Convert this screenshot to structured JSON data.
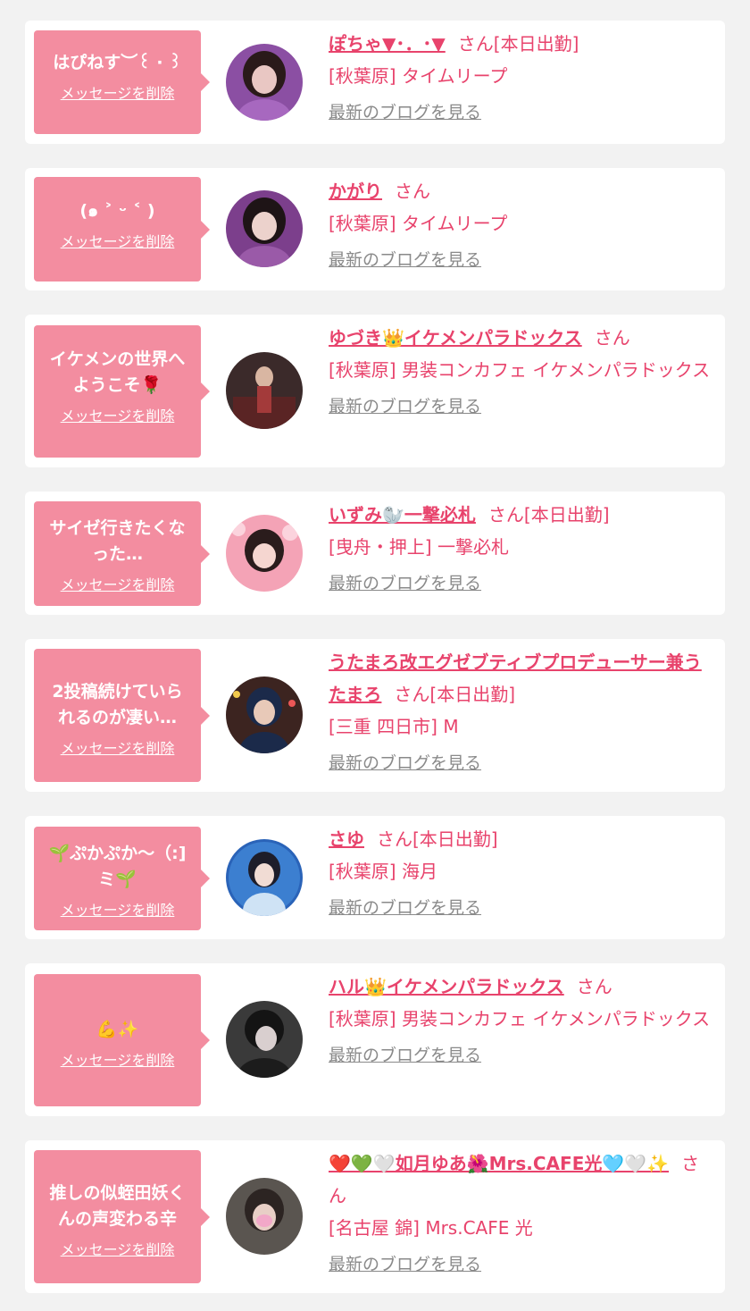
{
  "entries": [
    {
      "message": "はぴねす︶꒰ ‧ ꒱",
      "delete_label": "メッセージを削除",
      "name": "ぽちゃ▼･．･▼",
      "suffix": "さん[本日出勤]",
      "shop": "[秋葉原] タイムリープ",
      "blog_label": "最新のブログを見る",
      "avatar_colors": [
        "#8b4fa3",
        "#2a1a1a",
        "#e9c7c3"
      ]
    },
    {
      "message": "(๑ ˃ ᵕ ˂ )",
      "delete_label": "メッセージを削除",
      "name": "かがり",
      "suffix": "さん",
      "shop": "[秋葉原] タイムリープ",
      "blog_label": "最新のブログを見る",
      "avatar_colors": [
        "#7c3f8c",
        "#1e1416",
        "#ecd2cc"
      ]
    },
    {
      "message": "イケメンの世界へ\nようこそ🌹",
      "delete_label": "メッセージを削除",
      "name": "ゆづき👑イケメンパラドックス",
      "suffix": "さん",
      "shop": "[秋葉原] 男装コンカフェ イケメンパラドックス",
      "blog_label": "最新のブログを見る",
      "avatar_colors": [
        "#3b2a2a",
        "#a33a3a",
        "#d9b6a2"
      ]
    },
    {
      "message": "サイゼ行きたくな\nった…",
      "delete_label": "メッセージを削除",
      "name": "いずみ🦭一撃必札",
      "suffix": "さん[本日出勤]",
      "shop": "[曳舟・押上] 一撃必札",
      "blog_label": "最新のブログを見る",
      "avatar_colors": [
        "#f4a3b6",
        "#2a1c1c",
        "#f5d6d0"
      ]
    },
    {
      "message": "2投稿続けていら\nれるのが凄い…",
      "delete_label": "メッセージを削除",
      "name": "うたまろ改エグゼブティブプロデューサー兼うたまろ",
      "suffix": "さん[本日出勤]",
      "shop": "[三重 四日市] M",
      "blog_label": "最新のブログを見る",
      "avatar_colors": [
        "#3c2420",
        "#1b2a4a",
        "#e8c9b8"
      ]
    },
    {
      "message": "🌱ぷかぷか〜（:]\nミ🌱",
      "delete_label": "メッセージを削除",
      "name": "さゆ",
      "suffix": "さん[本日出勤]",
      "shop": "[秋葉原] 海月",
      "blog_label": "最新のブログを見る",
      "avatar_colors": [
        "#2a63b8",
        "#1d1d2a",
        "#cfe3f5"
      ]
    },
    {
      "message": "💪✨",
      "delete_label": "メッセージを削除",
      "name": "ハル👑イケメンパラドックス",
      "suffix": "さん",
      "shop": "[秋葉原] 男装コンカフェ イケメンパラドックス",
      "blog_label": "最新のブログを見る",
      "avatar_colors": [
        "#3a3a3a",
        "#141414",
        "#d9cfcf"
      ]
    },
    {
      "message": "推しの似蛭田妖く\nんの声変わる辛",
      "delete_label": "メッセージを削除",
      "name": "❤️💚🤍如月ゆあ🌺Mrs.CAFE光🩵🤍✨",
      "suffix": "さん",
      "shop": "[名古屋 錦] Mrs.CAFE 光",
      "blog_label": "最新のブログを見る",
      "avatar_colors": [
        "#5a5550",
        "#2c2422",
        "#f2a8c8"
      ]
    }
  ]
}
